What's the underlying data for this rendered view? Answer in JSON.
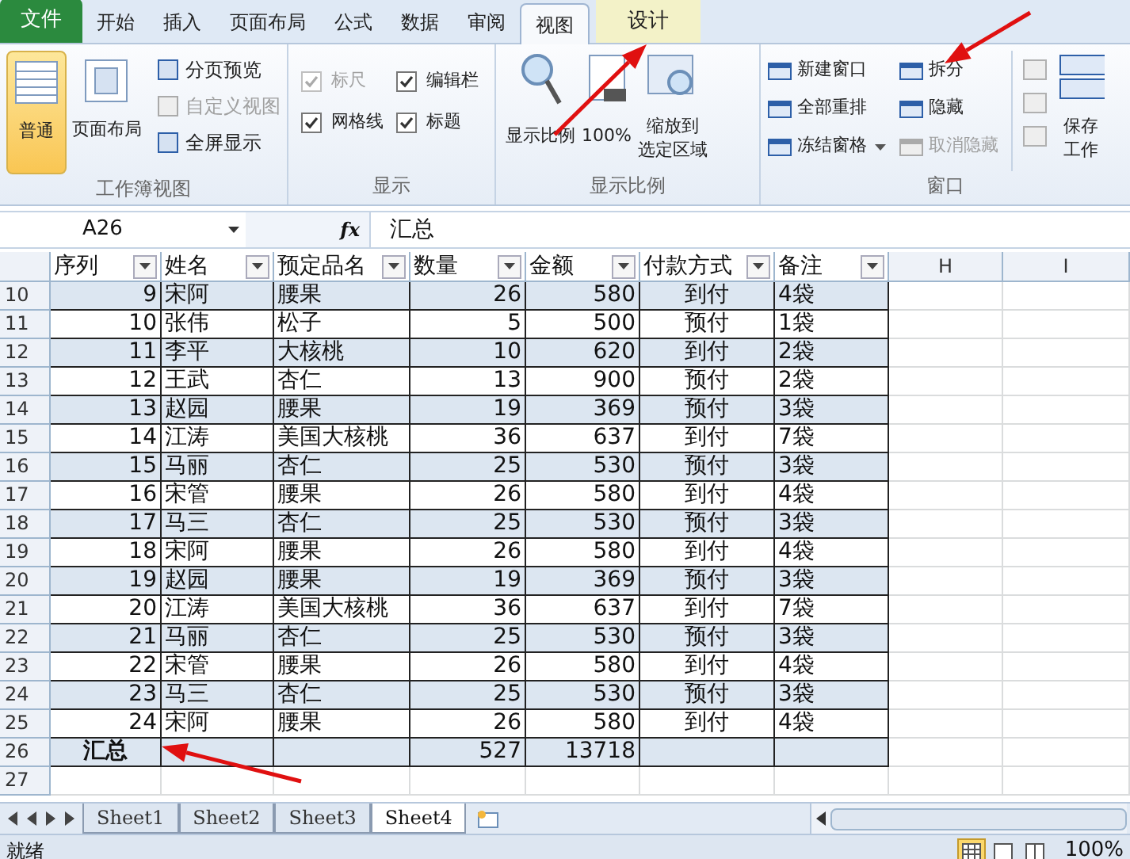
{
  "ribbon_tabs": [
    {
      "label": "文件",
      "kind": "file",
      "selected": false
    },
    {
      "label": "开始",
      "kind": "tab",
      "selected": false
    },
    {
      "label": "插入",
      "kind": "tab",
      "selected": false
    },
    {
      "label": "页面布局",
      "kind": "tab",
      "selected": false
    },
    {
      "label": "公式",
      "kind": "tab",
      "selected": false
    },
    {
      "label": "数据",
      "kind": "tab",
      "selected": false
    },
    {
      "label": "审阅",
      "kind": "tab",
      "selected": false
    },
    {
      "label": "视图",
      "kind": "tab",
      "selected": true
    },
    {
      "label": "设计",
      "kind": "contextual",
      "selected": false
    }
  ],
  "workbook_views": {
    "title": "工作簿视图",
    "large": [
      {
        "label": "普通",
        "selected": true
      },
      {
        "label": "页面布局",
        "selected": false
      }
    ],
    "small": [
      {
        "label": "分页预览",
        "disabled": false
      },
      {
        "label": "自定义视图",
        "disabled": true
      },
      {
        "label": "全屏显示",
        "disabled": false
      }
    ]
  },
  "show": {
    "title": "显示",
    "checks": [
      {
        "label": "标尺",
        "checked": true,
        "disabled": true
      },
      {
        "label": "编辑栏",
        "checked": true,
        "disabled": false
      },
      {
        "label": "网格线",
        "checked": true,
        "disabled": false
      },
      {
        "label": "标题",
        "checked": true,
        "disabled": false
      }
    ]
  },
  "zoom": {
    "title": "显示比例",
    "buttons": [
      {
        "label": "显示比例",
        "kind": "magnifier"
      },
      {
        "label": "100%",
        "kind": "page"
      },
      {
        "lines": [
          "缩放到",
          "选定区域"
        ],
        "kind": "selection"
      }
    ]
  },
  "window": {
    "title": "窗口",
    "items": [
      {
        "label": "新建窗口",
        "disabled": false,
        "dropdown": false
      },
      {
        "label": "全部重排",
        "disabled": false,
        "dropdown": false
      },
      {
        "label": "冻结窗格",
        "disabled": false,
        "dropdown": true
      },
      {
        "label": "拆分",
        "disabled": false,
        "dropdown": false
      },
      {
        "label": "隐藏",
        "disabled": false,
        "dropdown": false
      },
      {
        "label": "取消隐藏",
        "disabled": true,
        "dropdown": false
      }
    ],
    "save": {
      "lines": [
        "保存",
        "工作"
      ]
    }
  },
  "formula_bar": {
    "name_box": "A26",
    "function_label": "fx",
    "formula": "汇总"
  },
  "columns": [
    {
      "label": "序列",
      "kind": "table"
    },
    {
      "label": "姓名",
      "kind": "table"
    },
    {
      "label": "预定品名",
      "kind": "table"
    },
    {
      "label": "数量",
      "kind": "table"
    },
    {
      "label": "金额",
      "kind": "table"
    },
    {
      "label": "付款方式",
      "kind": "table"
    },
    {
      "label": "备注",
      "kind": "table"
    },
    {
      "label": "H",
      "kind": "letter"
    },
    {
      "label": "I",
      "kind": "letter"
    }
  ],
  "rows": [
    {
      "number": "10",
      "kind": "data",
      "cells": [
        "9",
        "宋阿",
        "腰果",
        "26",
        "580",
        "到付",
        "4袋"
      ]
    },
    {
      "number": "11",
      "kind": "data",
      "cells": [
        "10",
        "张伟",
        "松子",
        "5",
        "500",
        "预付",
        "1袋"
      ]
    },
    {
      "number": "12",
      "kind": "data",
      "cells": [
        "11",
        "李平",
        "大核桃",
        "10",
        "620",
        "到付",
        "2袋"
      ]
    },
    {
      "number": "13",
      "kind": "data",
      "cells": [
        "12",
        "王武",
        "杏仁",
        "13",
        "900",
        "预付",
        "2袋"
      ]
    },
    {
      "number": "14",
      "kind": "data",
      "cells": [
        "13",
        "赵园",
        "腰果",
        "19",
        "369",
        "预付",
        "3袋"
      ]
    },
    {
      "number": "15",
      "kind": "data",
      "cells": [
        "14",
        "江涛",
        "美国大核桃",
        "36",
        "637",
        "到付",
        "7袋"
      ]
    },
    {
      "number": "16",
      "kind": "data",
      "cells": [
        "15",
        "马丽",
        "杏仁",
        "25",
        "530",
        "预付",
        "3袋"
      ]
    },
    {
      "number": "17",
      "kind": "data",
      "cells": [
        "16",
        "宋管",
        "腰果",
        "26",
        "580",
        "到付",
        "4袋"
      ]
    },
    {
      "number": "18",
      "kind": "data",
      "cells": [
        "17",
        "马三",
        "杏仁",
        "25",
        "530",
        "预付",
        "3袋"
      ]
    },
    {
      "number": "19",
      "kind": "data",
      "cells": [
        "18",
        "宋阿",
        "腰果",
        "26",
        "580",
        "到付",
        "4袋"
      ]
    },
    {
      "number": "20",
      "kind": "data",
      "cells": [
        "19",
        "赵园",
        "腰果",
        "19",
        "369",
        "预付",
        "3袋"
      ]
    },
    {
      "number": "21",
      "kind": "data",
      "cells": [
        "20",
        "江涛",
        "美国大核桃",
        "36",
        "637",
        "到付",
        "7袋"
      ]
    },
    {
      "number": "22",
      "kind": "data",
      "cells": [
        "21",
        "马丽",
        "杏仁",
        "25",
        "530",
        "预付",
        "3袋"
      ]
    },
    {
      "number": "23",
      "kind": "data",
      "cells": [
        "22",
        "宋管",
        "腰果",
        "26",
        "580",
        "到付",
        "4袋"
      ]
    },
    {
      "number": "24",
      "kind": "data",
      "cells": [
        "23",
        "马三",
        "杏仁",
        "25",
        "530",
        "预付",
        "3袋"
      ]
    },
    {
      "number": "25",
      "kind": "data",
      "cells": [
        "24",
        "宋阿",
        "腰果",
        "26",
        "580",
        "到付",
        "4袋"
      ]
    },
    {
      "number": "26",
      "kind": "total",
      "cells": [
        "汇总",
        "",
        "",
        "527",
        "13718",
        "",
        ""
      ]
    },
    {
      "number": "27",
      "kind": "empty",
      "cells": []
    }
  ],
  "sheet_tabs": [
    {
      "label": "Sheet1",
      "selected": false
    },
    {
      "label": "Sheet2",
      "selected": false
    },
    {
      "label": "Sheet3",
      "selected": false
    },
    {
      "label": "Sheet4",
      "selected": true
    }
  ],
  "status_bar": {
    "status": "就绪",
    "views": [
      {
        "kind": "normal",
        "selected": true
      },
      {
        "kind": "layout",
        "selected": false
      },
      {
        "kind": "pagebreak",
        "selected": false
      }
    ],
    "zoom": "100%"
  }
}
